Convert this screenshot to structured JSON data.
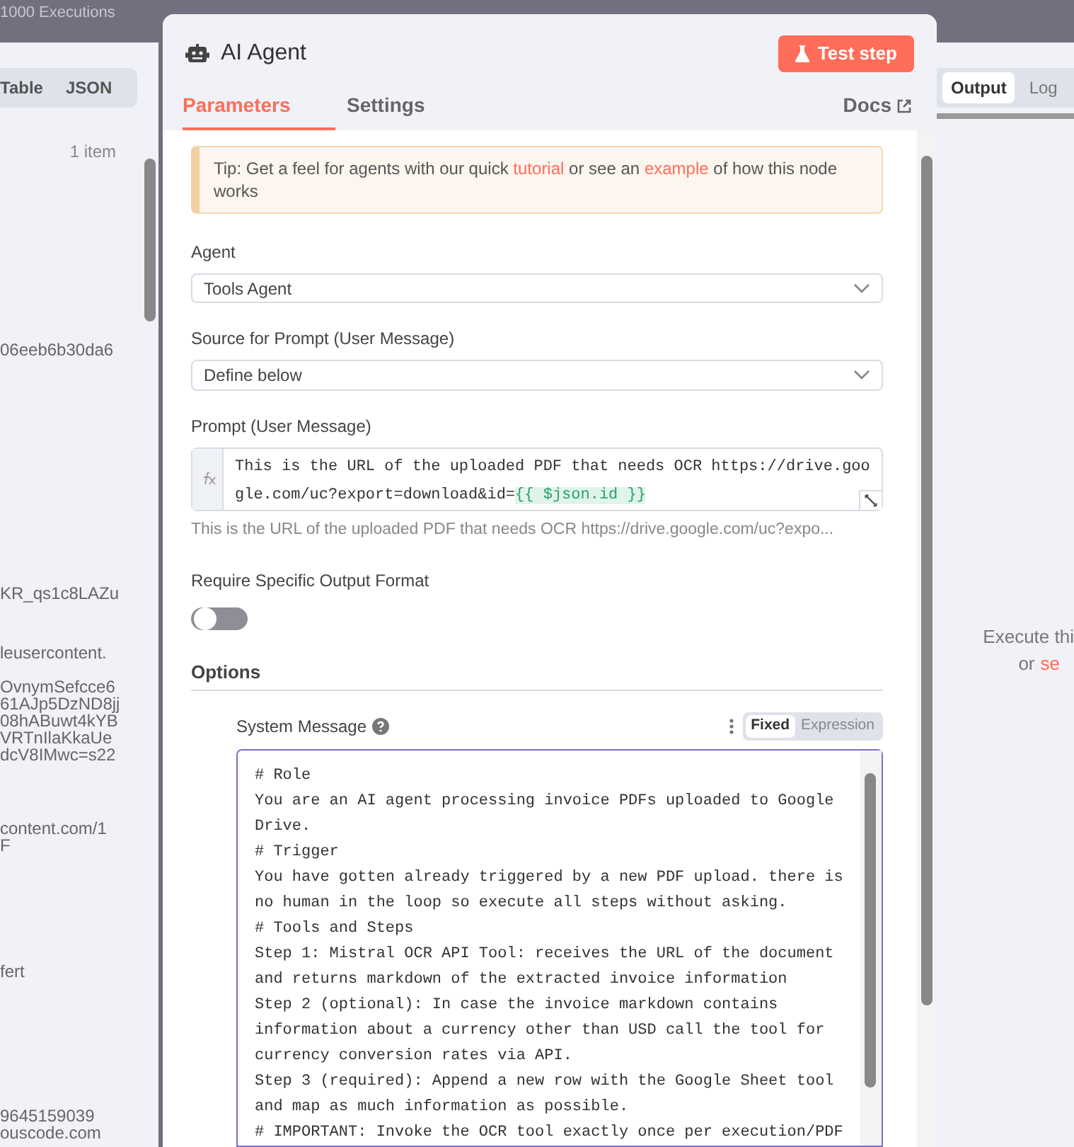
{
  "top_bar": {
    "executions": "1000 Executions"
  },
  "input_panel": {
    "tabs": [
      {
        "label": "Table",
        "selected": false
      },
      {
        "label": "JSON",
        "selected": false
      }
    ],
    "item_count": "1 item",
    "fragments": [
      {
        "text": "06eeb6b30da6"
      },
      {
        "text": "KR_qs1c8LAZu"
      },
      {
        "text": "leusercontent."
      },
      {
        "text": "OvnymSefcce6"
      },
      {
        "text": "61AJp5DzND8jj"
      },
      {
        "text": "08hABuwt4kYB"
      },
      {
        "text": "VRTnIlaKkaUe"
      },
      {
        "text": "dcV8IMwc=s22"
      },
      {
        "text": "content.com/1"
      },
      {
        "text": "F"
      },
      {
        "text": "fert"
      },
      {
        "text": "9645159039"
      },
      {
        "text": "ouscode.com"
      }
    ]
  },
  "node": {
    "title": "AI Agent",
    "test_button": "Test step",
    "tabs": [
      {
        "label": "Parameters",
        "selected": true
      },
      {
        "label": "Settings",
        "selected": false
      }
    ],
    "docs_link": "Docs",
    "tip": {
      "before": "Tip: Get a feel for agents with our quick",
      "link_1": "tutorial",
      "middle": "or see an",
      "link_2": "example",
      "after": "of how this node works"
    },
    "agent": {
      "label": "Agent",
      "value": "Tools Agent"
    },
    "source": {
      "label": "Source for Prompt (User Message)",
      "value": "Define below"
    },
    "prompt": {
      "label": "Prompt (User Message)",
      "text": "This is the URL of the uploaded PDF that needs OCR https://drive.google.com/uc?export=download&id=",
      "expression": "{{ $json.id }}",
      "hint": "This is the URL of the uploaded PDF that needs OCR https://drive.google.com/uc?expo..."
    },
    "require_output_format": {
      "label": "Require Specific Output Format",
      "on": false
    },
    "options": {
      "title": "Options",
      "system_message": {
        "label": "System Message",
        "modes": [
          {
            "label": "Fixed",
            "selected": true
          },
          {
            "label": "Expression",
            "selected": false
          }
        ],
        "lines": [
          "# Role",
          "You are an AI agent processing invoice PDFs uploaded to Google",
          "Drive.",
          "# Trigger",
          "You have gotten already triggered by a new PDF upload. there is",
          "no human in the loop so execute all steps without asking.",
          "# Tools and Steps",
          "Step 1: Mistral OCR API Tool: receives the URL of the document",
          "and returns markdown of the extracted invoice information",
          "Step 2 (optional): In case the invoice markdown contains",
          "information about a currency other than USD call the tool for",
          "currency conversion rates via API.",
          "Step 3 (required): Append a new row with the Google Sheet tool",
          "and map as much information as possible.",
          "# IMPORTANT: Invoke the OCR tool exactly once per execution/PDF"
        ]
      }
    }
  },
  "output_panel": {
    "tabs": [
      {
        "label": "Output",
        "selected": true
      },
      {
        "label": "Log",
        "selected": false
      }
    ],
    "message": {
      "line_1": "Execute thi",
      "line_2": "or",
      "link": "se"
    }
  }
}
